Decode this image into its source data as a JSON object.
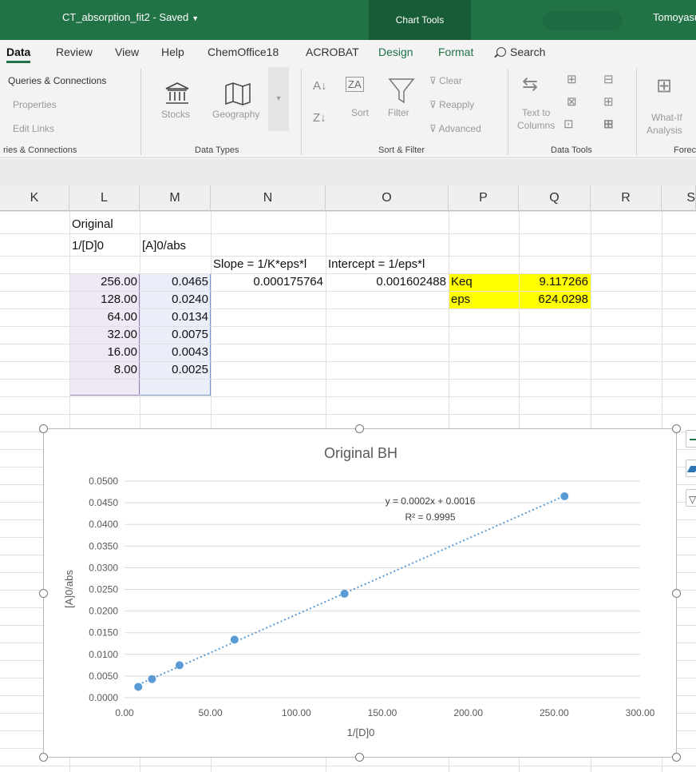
{
  "window": {
    "title": "CT_absorption_fit2 - Saved",
    "chart_tools": "Chart Tools",
    "user": "Tomoyasu"
  },
  "tabs": [
    {
      "label": "Data"
    },
    {
      "label": "Review"
    },
    {
      "label": "View"
    },
    {
      "label": "Help"
    },
    {
      "label": "ChemOffice18"
    },
    {
      "label": "ACROBAT"
    },
    {
      "label": "Design"
    },
    {
      "label": "Format"
    },
    {
      "label": "Search"
    }
  ],
  "ribbon": {
    "queries": {
      "connections": "Queries & Connections",
      "properties": "Properties",
      "edit_links": "Edit Links",
      "group": "ries & Connections"
    },
    "data_types": {
      "stocks": "Stocks",
      "geography": "Geography",
      "group": "Data Types"
    },
    "sort_filter": {
      "sort": "Sort",
      "filter": "Filter",
      "clear": "Clear",
      "reapply": "Reapply",
      "advanced": "Advanced",
      "group": "Sort & Filter"
    },
    "data_tools": {
      "text_to": "Text to",
      "columns": "Columns",
      "group": "Data Tools"
    },
    "forecast": {
      "what_if": "What-If",
      "analysis": "Analysis",
      "group": "Forec"
    }
  },
  "sheet": {
    "columns": [
      "K",
      "L",
      "M",
      "N",
      "O",
      "P",
      "Q",
      "R",
      "S"
    ],
    "header1": "Original",
    "header_L": "1/[D]0",
    "header_M": "[A]0/abs",
    "slope_label": "Slope = 1/K*eps*l",
    "intercept_label": "Intercept = 1/eps*l",
    "slope_value": "0.000175764",
    "intercept_value": "0.001602488",
    "keq_label": "Keq",
    "keq_value": "9.117266",
    "eps_label": "eps",
    "eps_value": "624.0298",
    "rows": [
      {
        "L": "256.00",
        "M": "0.0465"
      },
      {
        "L": "128.00",
        "M": "0.0240"
      },
      {
        "L": "64.00",
        "M": "0.0134"
      },
      {
        "L": "32.00",
        "M": "0.0075"
      },
      {
        "L": "16.00",
        "M": "0.0043"
      },
      {
        "L": "8.00",
        "M": "0.0025"
      }
    ]
  },
  "chart_data": {
    "type": "scatter",
    "title": "Original BH",
    "xlabel": "1/[D]0",
    "ylabel": "[A]0/abs",
    "xlim": [
      0,
      300
    ],
    "ylim": [
      0,
      0.05
    ],
    "x_ticks": [
      "0.00",
      "50.00",
      "100.00",
      "150.00",
      "200.00",
      "250.00",
      "300.00"
    ],
    "y_ticks": [
      "0.0000",
      "0.0050",
      "0.0100",
      "0.0150",
      "0.0200",
      "0.0250",
      "0.0300",
      "0.0350",
      "0.0400",
      "0.0450",
      "0.0500"
    ],
    "x": [
      256,
      128,
      64,
      32,
      16,
      8
    ],
    "y": [
      0.0465,
      0.024,
      0.0134,
      0.0075,
      0.0043,
      0.0025
    ],
    "trendline": {
      "slope": 0.000175764,
      "intercept": 0.001602488,
      "equation": "y = 0.0002x + 0.0016",
      "r2": "R² = 0.9995"
    },
    "grid": true,
    "color": "#5b9bd5"
  }
}
